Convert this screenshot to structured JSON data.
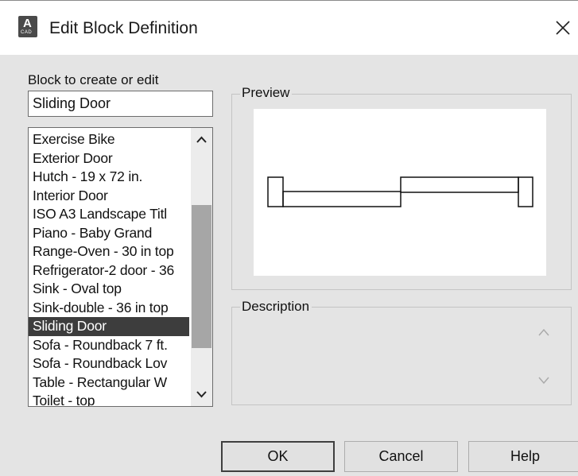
{
  "window": {
    "title": "Edit Block Definition",
    "app_icon": "autocad-icon",
    "app_icon_letter": "A",
    "app_icon_caption": "CAD",
    "close_glyph": "✕"
  },
  "block_label": "Block to create or edit",
  "block_name_value": "Sliding Door",
  "block_list": {
    "items": [
      "Exercise Bike",
      "Exterior Door",
      "Hutch - 19 x 72 in.",
      "Interior Door",
      "ISO A3 Landscape Titl",
      "Piano - Baby Grand",
      "Range-Oven - 30 in top",
      "Refrigerator-2 door - 36",
      "Sink - Oval top",
      "Sink-double - 36 in top",
      "Sliding Door",
      "Sofa - Roundback 7 ft.",
      "Sofa - Roundback Lov",
      "Table - Rectangular W",
      "Toilet - top"
    ],
    "selected": "Sliding Door"
  },
  "preview": {
    "label": "Preview"
  },
  "description": {
    "label": "Description",
    "value": ""
  },
  "buttons": {
    "ok": "OK",
    "cancel": "Cancel",
    "help": "Help"
  },
  "colors": {
    "selection_bg": "#3d3d3d",
    "dialog_bg": "#e4e4e4"
  }
}
